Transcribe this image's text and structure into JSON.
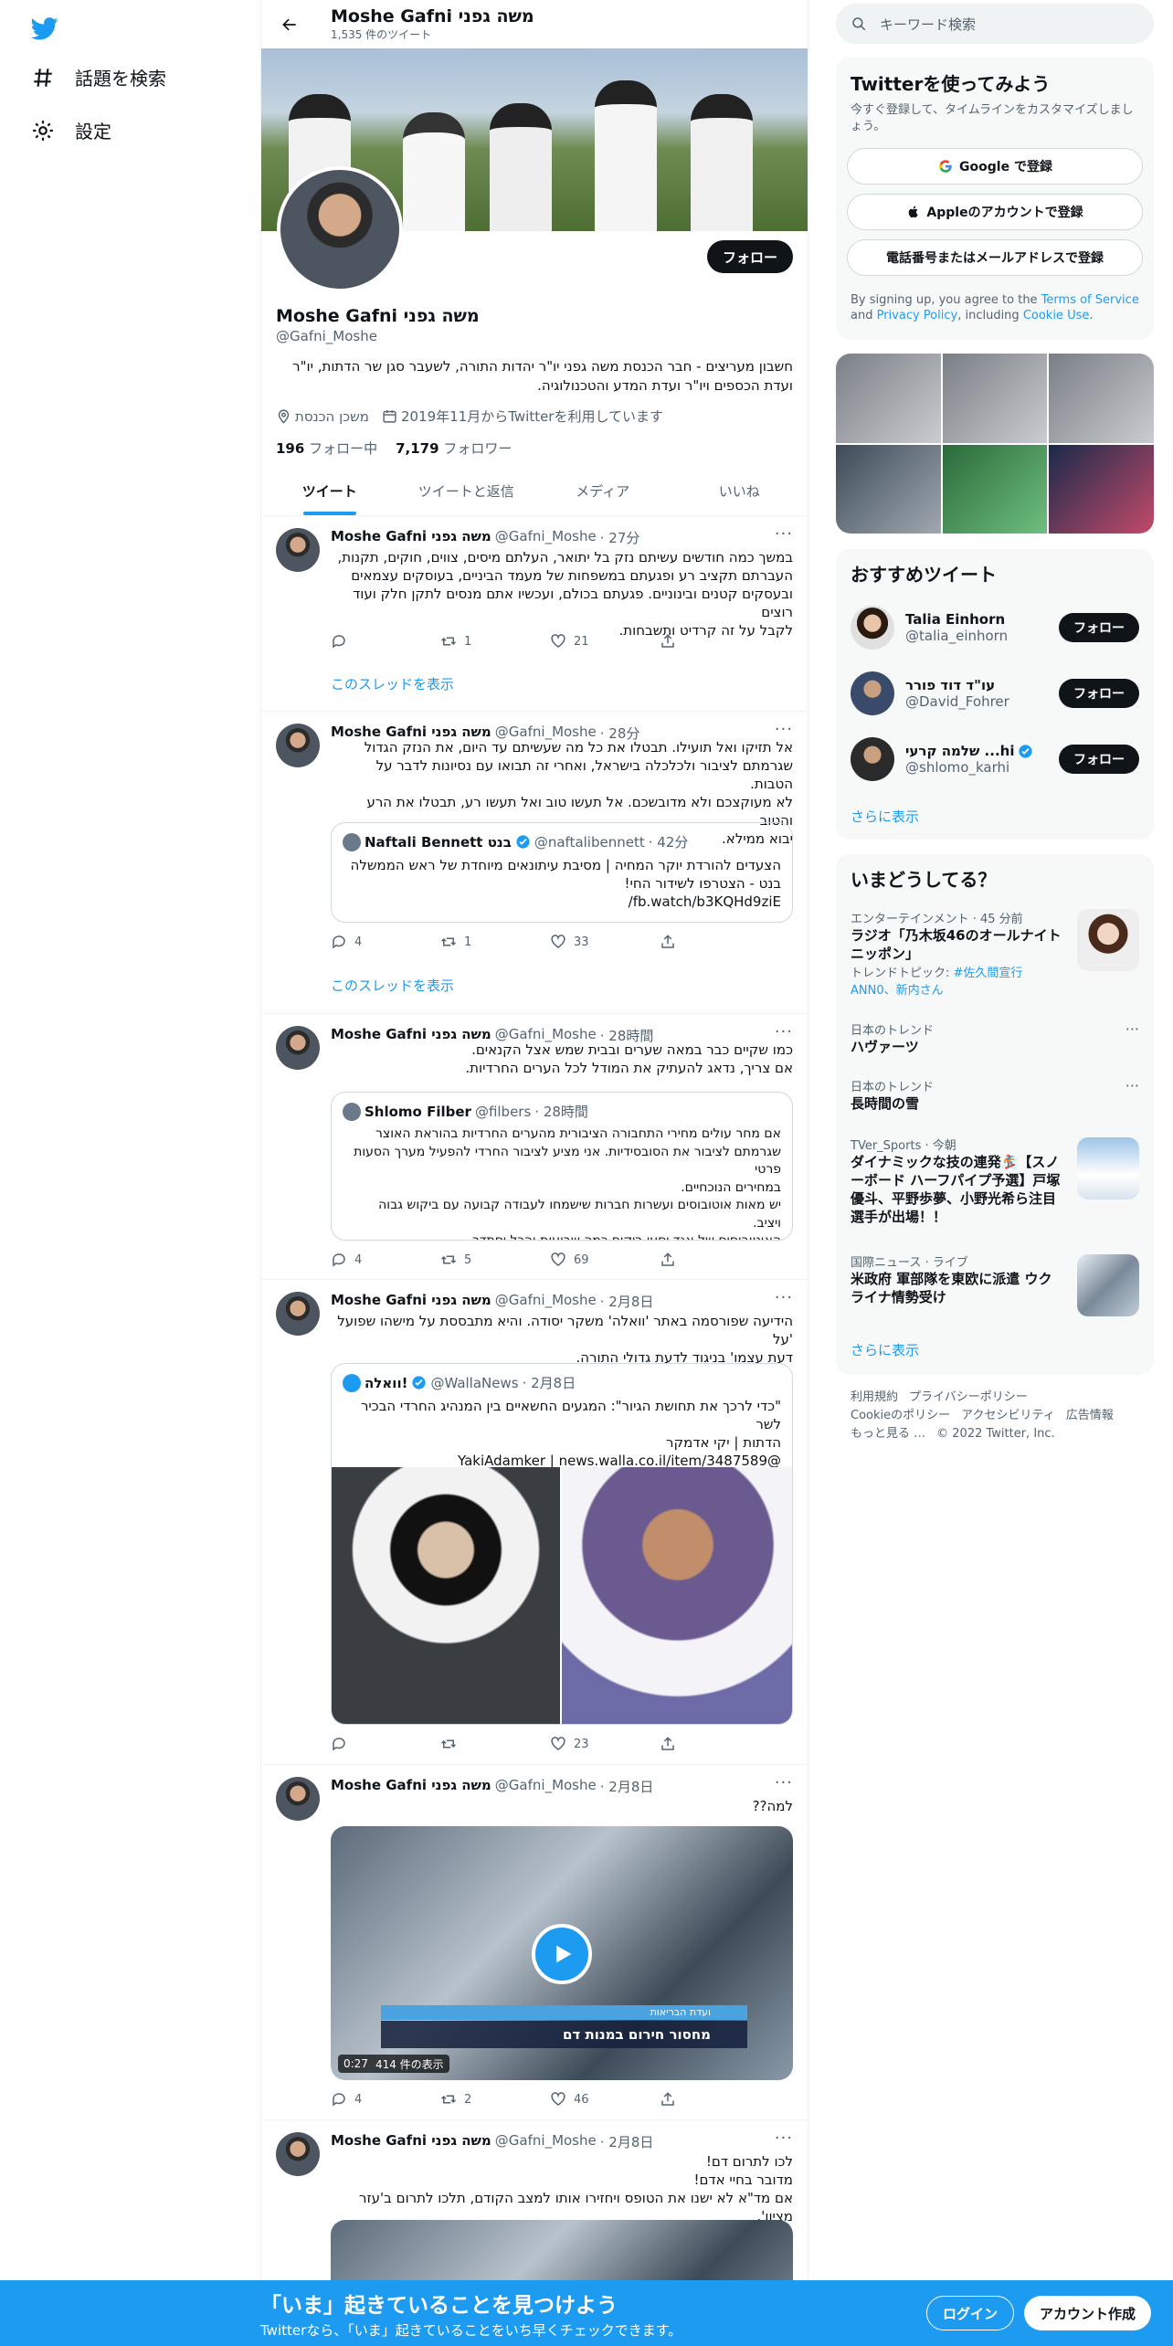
{
  "nav": {
    "explore_label": "話題を検索",
    "settings_label": "設定"
  },
  "profile": {
    "name": "Moshe Gafni משה גפני",
    "tweet_count": "1,535 件のツイート",
    "handle": "@Gafni_Moshe",
    "follow_label": "フォロー",
    "bio": "חשבון מעריצים - חבר הכנסת משה גפני יו\"ר יהדות התורה, לשעבר סגן שר הדתות, יו\"ר ועדת הכספים ויו\"ר ועדת המדע והטכנולוגיה.",
    "location": "משכן הכנסת",
    "joined": "2019年11月からTwitterを利用しています",
    "following_count": "196",
    "following_label": "フォロー中",
    "followers_count": "7,179",
    "followers_label": "フォロワー",
    "tabs": [
      "ツイート",
      "ツイートと返信",
      "メディア",
      "いいね"
    ]
  },
  "tweets": [
    {
      "name": "Moshe Gafni משה גפני",
      "handle": "@Gafni_Moshe",
      "time": "· 27分",
      "text": "במשך כמה חודשים עשיתם נזק בל יתואר, העלתם מיסים, צווים, חוקים, תקנות,\nהעברתם תקציב רע ופגעתם במשפחות של מעמד הביניים, בעוסקים עצמאים\nובעסקים קטנים ובינוניים. פגעתם בכולם, ועכשיו אתם מנסים לתקן חלק ועוד רוצים\nלקבל על זה קרדיט ותשבחות.",
      "replies": "",
      "retweets": "1",
      "likes": "21",
      "thread_link": "このスレッドを表示"
    },
    {
      "name": "Moshe Gafni משה גפני",
      "handle": "@Gafni_Moshe",
      "time": "· 28分",
      "text": "אל תזיקו ואל תועילו. תבטלו את כל מה שעשיתם עד היום, את הנזק הגדול\nשגרמתם לציבור ולכלכלה בישראל, ואחרי זה תבואו עם נסיונות לדבר על הטבות.\nלא מעוקצכם ולא מדובשכם. אל תעשו טוב ואל תעשו רע, תבטלו את הרע והטוב\nיבוא ממילא.",
      "quote": {
        "name": "Naftali Bennett בנט",
        "handle": "@naftalibennett",
        "time": "· 42分",
        "text": "הצעדים להורדת יוקר המחיה | מסיבת עיתונאים מיוחדת של ראש הממשלה\nבנט - הצטרפו לשידור החי!\nfb.watch/b3KQHd9ziE/"
      },
      "replies": "4",
      "retweets": "1",
      "likes": "33",
      "thread_link": "このスレッドを表示"
    },
    {
      "name": "Moshe Gafni משה גפני",
      "handle": "@Gafni_Moshe",
      "time": "· 28時間",
      "text": "כמו שקיים כבר במאה שערים ובבית שמש אצל הקנאים.\nאם צריך, נדאג להעתיק את המודל לכל הערים החרדיות.",
      "quote": {
        "name": "Shlomo Filber",
        "handle": "@filbers",
        "time": "· 28時間",
        "text": "אם מחר עולים מחירי התחבורה הציבורית מהערים החרדיות בהוראת האוצר\nשגרמתם לציבור את הסובסידיות. אני מציע לציבור החרדי להפעיל מערך הסעות פרטי\nבמחירים הנוכחיים.\nיש מאות אוטובוסים ועשרות חברות שישמחו לעבודה קבועה עם ביקוש גבוה\nויציב.\nהאוטובוסים של אגד יסעו ריקים כמה שבועות והכל יסתדר."
      },
      "replies": "4",
      "retweets": "5",
      "likes": "69"
    },
    {
      "name": "Moshe Gafni משה גפני",
      "handle": "@Gafni_Moshe",
      "time": "· 2月8日",
      "text": "הידיעה שפורסמה באתר 'וואלה' משקר יסודה. והיא מתבססת על מישהו שפועל 'על\nדעת עצמו' בניגוד לדעת גדולי התורה.",
      "quote": {
        "name": "וואלה!",
        "handle": "@WallaNews",
        "time": "· 2月8日",
        "text": "\"כדי לרכך את תחושת הגיור\": המגעים החשאיים בין המנהיג החרדי הבכיר לשר\nהדתות | יקי אדמקר\n@YakiAdamker | news.walla.co.il/item/3487589"
      },
      "replies": "",
      "retweets": "",
      "likes": "23"
    },
    {
      "name": "Moshe Gafni משה גפני",
      "handle": "@Gafni_Moshe",
      "time": "· 2月8日",
      "text": "למה??",
      "video": {
        "duration": "0:27",
        "views": "414 件の表示",
        "caption_top": "ועדת הבריאות",
        "caption_main": "מחסור חירום במנות דם"
      },
      "replies": "4",
      "retweets": "2",
      "likes": "46"
    },
    {
      "name": "Moshe Gafni משה גפני",
      "handle": "@Gafni_Moshe",
      "time": "· 2月8日",
      "text": "לכו לתרום דם!\nמדובר בחיי אדם!\nאם מד\"א לא ישנו את הטופס ויחזירו אותו למצב הקודם, תלכו לתרום ב'עזר מציון'."
    }
  ],
  "right": {
    "search_placeholder": "キーワード検索",
    "signup": {
      "title": "Twitterを使ってみよう",
      "subtitle": "今すぐ登録して、タイムラインをカスタマイズしましょう。",
      "google": "Google で登録",
      "apple": "Appleのアカウントで登録",
      "phone": "電話番号またはメールアドレスで登録",
      "terms_prefix": "By signing up, you agree to the ",
      "terms": "Terms of Service",
      "and": " and ",
      "privacy": "Privacy Policy",
      "including": ", including ",
      "cookie": "Cookie Use",
      "period": "."
    },
    "recommend": {
      "title": "おすすめツイート",
      "users": [
        {
          "name": "Talia Einhorn",
          "handle": "@talia_einhorn"
        },
        {
          "name": "עו\"ד דוד פורר",
          "handle": "@David_Fohrer"
        },
        {
          "name": "שלמה קרעי ...hi",
          "handle": "@shlomo_karhi"
        }
      ],
      "follow_label": "フォロー",
      "more": "さらに表示"
    },
    "trends": {
      "title": "いまどうしてる？",
      "items": [
        {
          "category": "エンターテインメント · 45 分前",
          "title": "ラジオ「乃木坂46のオールナイトニッポン」",
          "sub_prefix": "トレンドトピック: ",
          "sub_link": "#佐久間宣行ANN0、新内さん"
        },
        {
          "category": "日本のトレンド",
          "title": "ハヴァーツ"
        },
        {
          "category": "日本のトレンド",
          "title": "長時間の雪"
        },
        {
          "category": "TVer_Sports · 今朝",
          "title": "ダイナミックな技の連発🏂【スノーボード ハーフパイプ予選】戸塚優斗、平野歩夢、小野光希ら注目選手が出場！！"
        },
        {
          "category": "国際ニュース · ライブ",
          "title": "米政府 軍部隊を東欧に派遣 ウクライナ情勢受け"
        }
      ],
      "more": "さらに表示"
    },
    "footer": [
      "利用規約",
      "プライバシーポリシー",
      "Cookieのポリシー",
      "アクセシビリティ",
      "広告情報",
      "もっと見る …",
      "© 2022 Twitter, Inc."
    ]
  },
  "bottombar": {
    "title": "「いま」起きていることを見つけよう",
    "subtitle": "Twitterなら、「いま」起きていることをいち早くチェックできます。",
    "login": "ログイン",
    "signup": "アカウント作成"
  },
  "colors": {
    "accent": "#1d9bf0",
    "text": "#0f1419",
    "muted": "#536471"
  }
}
